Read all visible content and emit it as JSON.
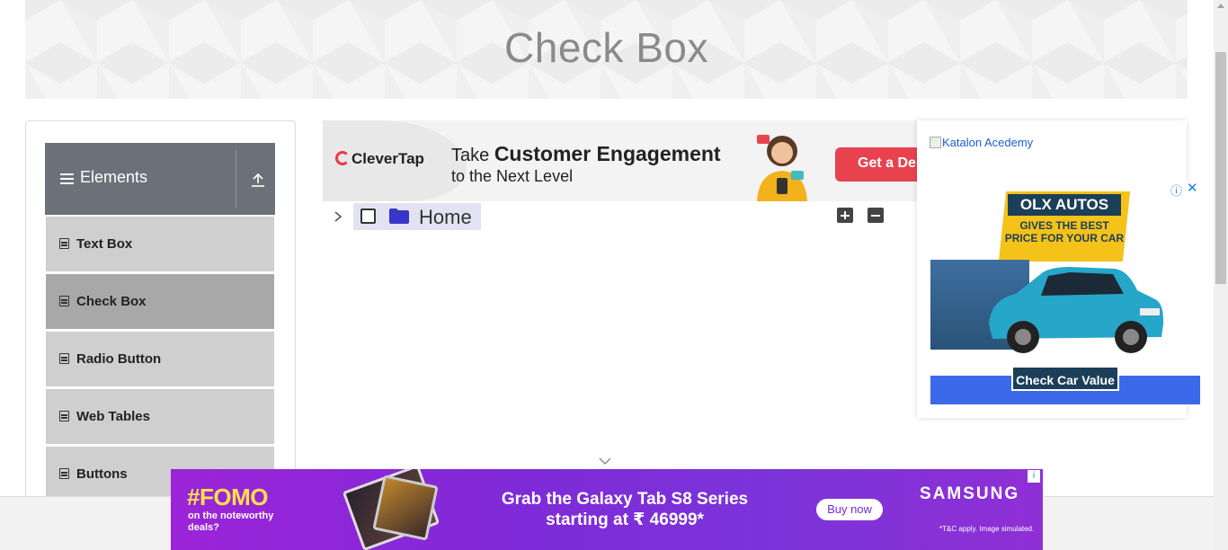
{
  "page": {
    "title": "Check Box"
  },
  "sidebar": {
    "group_label": "Elements",
    "items": [
      {
        "label": "Text Box",
        "active": false
      },
      {
        "label": "Check Box",
        "active": true
      },
      {
        "label": "Radio Button",
        "active": false
      },
      {
        "label": "Web Tables",
        "active": false
      },
      {
        "label": "Buttons",
        "active": false
      }
    ]
  },
  "top_ad": {
    "brand": "CleverTap",
    "line1_prefix": "Take ",
    "line1_bold": "Customer Engagement",
    "line2": "to the Next Level",
    "cta": "Get a De"
  },
  "tree": {
    "root_label": "Home",
    "checked": false,
    "expanded": false
  },
  "right_ad": {
    "katalon_alt": "Katalon Acedemy",
    "olx_title": "OLX AUTOS",
    "olx_tagline": "GIVES THE BEST PRICE FOR YOUR CAR",
    "olx_cta": "Check Car Value"
  },
  "bottom_ad": {
    "fomo": "#FOMO",
    "fomo_sub": "on the noteworthy deals?",
    "headline_line1": "Grab the Galaxy Tab S8 Series",
    "headline_line2": "starting at ₹  46999*",
    "buy": "Buy now",
    "brand": "SAMSUNG",
    "tc": "*T&C apply. Image simulated."
  },
  "colors": {
    "sidebar_header": "#6b7179",
    "menu_item": "#cfcfcf",
    "menu_item_active": "#a8a8a8",
    "tree_highlight": "#e2e2f3",
    "folder_icon": "#3636c9"
  }
}
